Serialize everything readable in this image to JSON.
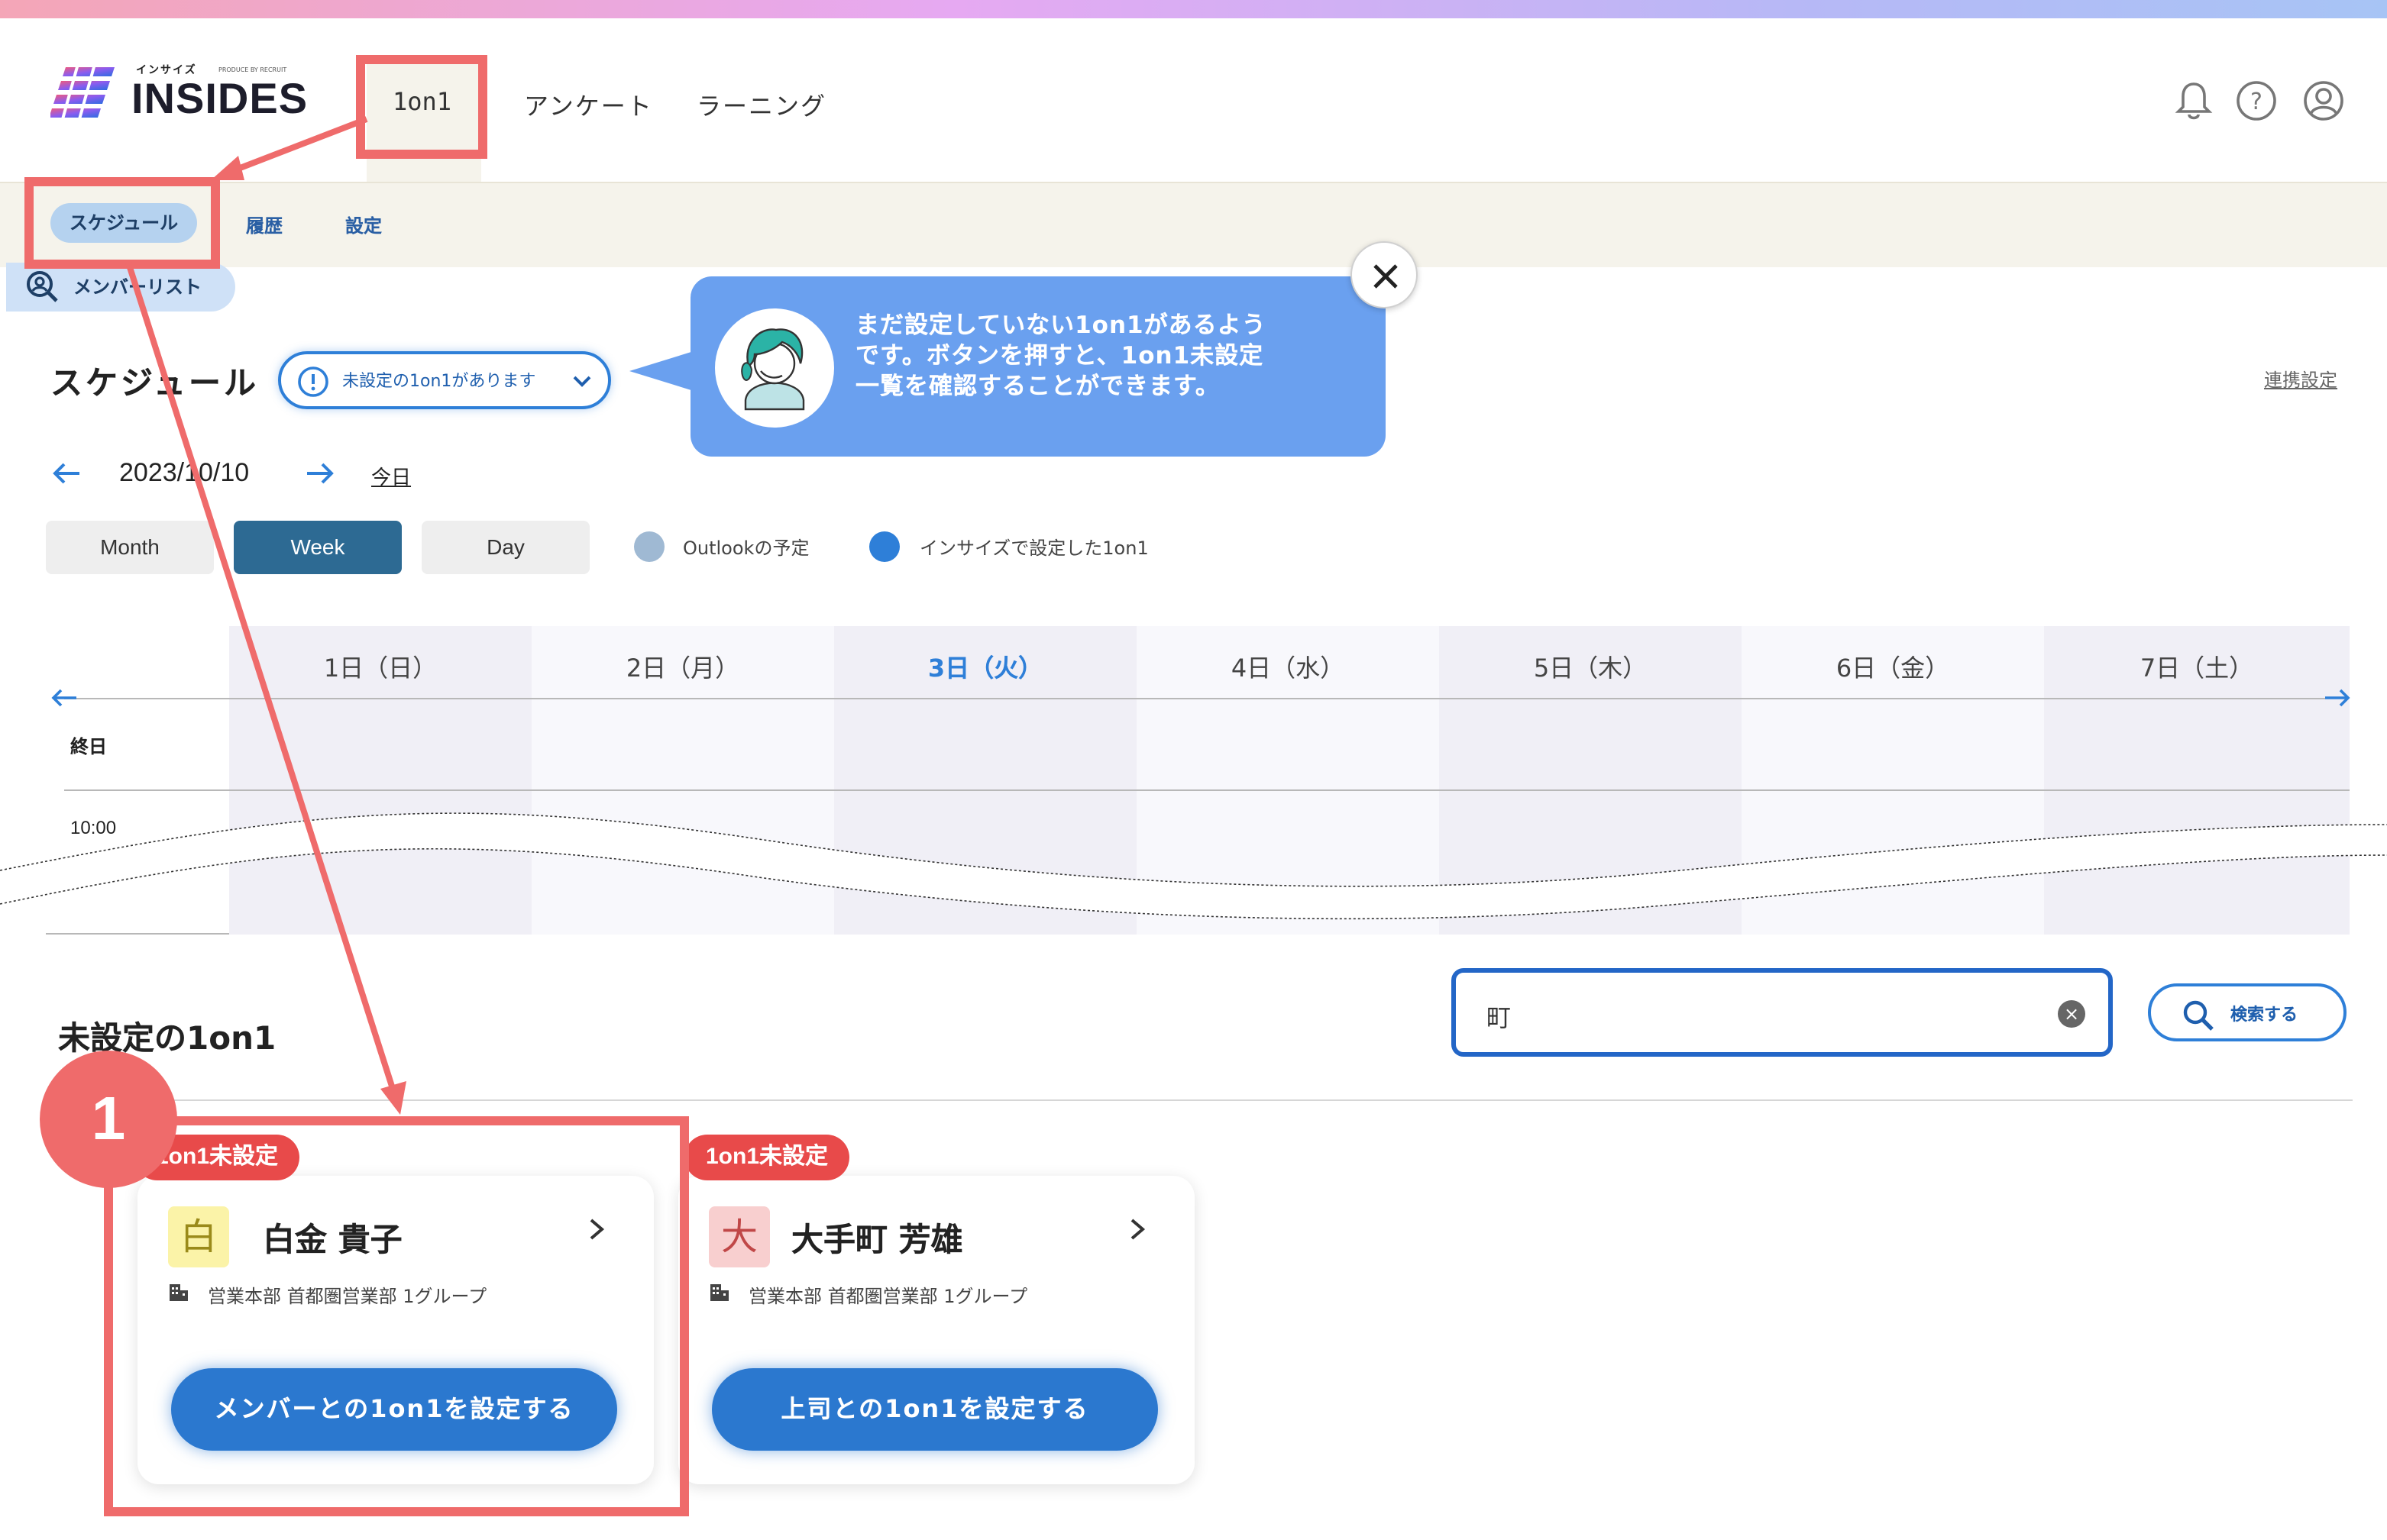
{
  "app": {
    "logo_ruby": "インサイズ",
    "logo_ruby_small": "PRODUCE BY RECRUIT",
    "logo_text": "INSIDES"
  },
  "nav": {
    "items": [
      {
        "label": "1on1"
      },
      {
        "label": "アンケート"
      },
      {
        "label": "ラーニング"
      }
    ],
    "icons": [
      "bell-icon",
      "help-icon",
      "user-icon"
    ]
  },
  "subnav": {
    "items": [
      {
        "label": "スケジュール"
      },
      {
        "label": "履歴"
      },
      {
        "label": "設定"
      }
    ],
    "member_list": "メンバーリスト"
  },
  "schedule": {
    "title": "スケジュール",
    "alert": "未設定の1on1があります",
    "link_setting": "連携設定",
    "date": "2023/10/10",
    "today": "今日",
    "view_modes": [
      "Month",
      "Week",
      "Day"
    ],
    "selected_view": "Week",
    "legend": [
      {
        "label": "Outlookの予定",
        "color": "#9fb9d3"
      },
      {
        "label": "インサイズで設定した1on1",
        "color": "#2e7fd8"
      }
    ],
    "days": [
      "1日（日）",
      "2日（月）",
      "3日（火）",
      "4日（水）",
      "5日（木）",
      "6日（金）",
      "7日（土）"
    ],
    "highlighted_day": "3日（火）",
    "allday_label": "終日",
    "time_label": "10:00"
  },
  "tooltip": {
    "line1": "まだ設定していない1on1があるよう",
    "line2": "です。ボタンを押すと、1on1未設定",
    "line3": "一覧を確認することができます。"
  },
  "unset": {
    "title": "未設定の1on1",
    "search_value": "町",
    "search_button": "検索する",
    "cards": [
      {
        "badge": "1on1未設定",
        "avatar": "白",
        "avatar_bg": "#fbf3a8",
        "avatar_color": "#9a8a1a",
        "name": "白金 貴子",
        "org": "営業本部 首都圏営業部 1グループ",
        "action": "メンバーとの1on1を設定する"
      },
      {
        "badge": "1on1未設定",
        "avatar": "大",
        "avatar_bg": "#f8cfcf",
        "avatar_color": "#c04747",
        "name": "大手町 芳雄",
        "org": "営業本部 首都圏営業部 1グループ",
        "action": "上司との1on1を設定する"
      }
    ]
  },
  "annotation": {
    "step_number": "1",
    "highlight_color": "#ef6b6b"
  }
}
